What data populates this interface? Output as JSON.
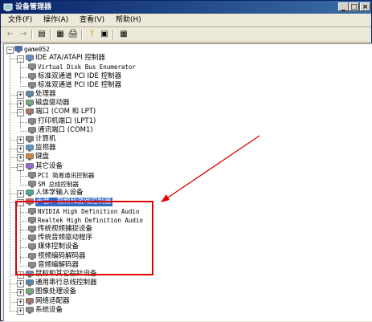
{
  "window": {
    "title": "设备管理器",
    "btn_min": "_",
    "btn_max": "□",
    "btn_close": "×"
  },
  "menu": [
    "文件(F)",
    "操作(A)",
    "查看(V)",
    "帮助(H)"
  ],
  "toolbar": {
    "back": "←",
    "forward": "→",
    "b1": "▤",
    "b2": "▦",
    "b3": "🖨",
    "b4": "?",
    "b5": "▣",
    "b6": "▦"
  },
  "tree": {
    "root": "game052",
    "nodes": [
      {
        "label": "IDE ATA/ATAPI 控制器",
        "expanded": true,
        "children": [
          "Virtual Disk Bus Enumerator",
          "标准双通道 PCI IDE 控制器",
          "标准双通道 PCI IDE 控制器"
        ]
      },
      {
        "label": "处理器",
        "expanded": false
      },
      {
        "label": "磁盘驱动器",
        "expanded": false
      },
      {
        "label": "端口 (COM 和 LPT)",
        "expanded": true,
        "children": [
          "打印机端口 (LPT1)",
          "通讯端口 (COM1)"
        ]
      },
      {
        "label": "计算机",
        "expanded": false
      },
      {
        "label": "监视器",
        "expanded": false
      },
      {
        "label": "键盘",
        "expanded": false
      },
      {
        "label": "其它设备",
        "expanded": true,
        "children": [
          "PCI 简易通讯控制器",
          "SM 总线控制器"
        ]
      },
      {
        "label": "人体学输入设备",
        "expanded": false
      },
      {
        "label": "声音、视频和游戏控制器",
        "expanded": true,
        "selected": true,
        "children": [
          "NVIDIA High Definition Audio",
          "Realtek High Definition Audio",
          "传统视频捕捉设备",
          "传统音频驱动程序",
          "媒体控制设备",
          "视频编码解码器",
          "音频编解码器"
        ]
      },
      {
        "label": "鼠标和其它指针设备",
        "expanded": false
      },
      {
        "label": "通用串行总线控制器",
        "expanded": false
      },
      {
        "label": "图像处理设备",
        "expanded": false
      },
      {
        "label": "网络适配器",
        "expanded": false
      },
      {
        "label": "系统设备",
        "expanded": false
      }
    ]
  },
  "colors": {
    "title_start": "#0a246a",
    "title_end": "#3a6ea5",
    "selection": "#316ac5",
    "annotation": "#e00000"
  }
}
